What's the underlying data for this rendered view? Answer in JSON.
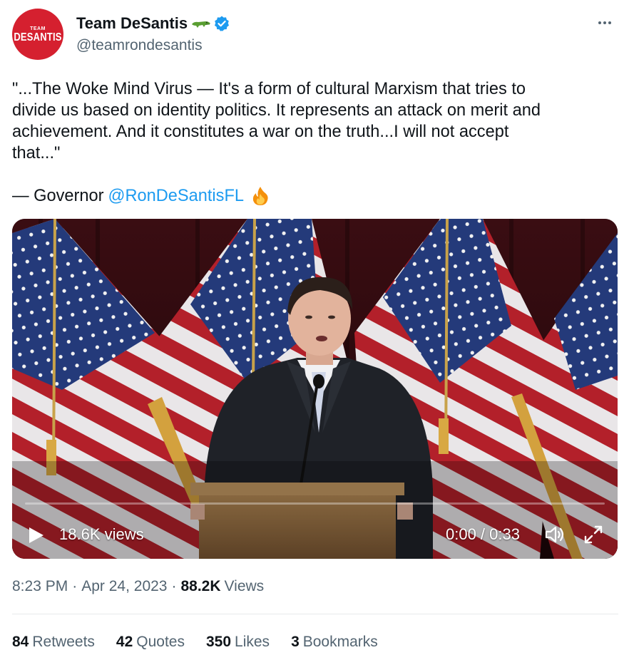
{
  "author": {
    "display_name": "Team DeSantis",
    "handle": "@teamrondesantis",
    "avatar_text_small": "TEAM",
    "avatar_text_big": "DESANTIS",
    "avatar_color": "#d5202f",
    "badge_icon": "verified-badge-icon",
    "emoji_icon": "alligator-icon"
  },
  "tweet": {
    "text": "\"...The Woke Mind Virus — It's a form of cultural Marxism that tries to\ndivide us based on identity politics. It represents an attack on merit and\nachievement. And it constitutes a war on the truth...I will not accept\nthat...\"",
    "sign_prefix": "— Governor",
    "mention": "@RonDeSantisFL",
    "emoji_icon": "fire-icon"
  },
  "video": {
    "views": "18.6K views",
    "time": "0:00 / 0:33",
    "progress": 0.0,
    "controls": [
      "play-icon",
      "volume-icon",
      "fullscreen-icon"
    ]
  },
  "meta": {
    "time": "8:23 PM",
    "separator": "·",
    "date": "Apr 24, 2023",
    "views_count": "88.2K",
    "views_word": "Views"
  },
  "stats": [
    {
      "count": "84",
      "label": "Retweets"
    },
    {
      "count": "42",
      "label": "Quotes"
    },
    {
      "count": "350",
      "label": "Likes"
    },
    {
      "count": "3",
      "label": "Bookmarks"
    }
  ],
  "colors": {
    "link": "#1d9bf0",
    "secondary_text": "#536471",
    "primary_text": "#0f1419"
  }
}
